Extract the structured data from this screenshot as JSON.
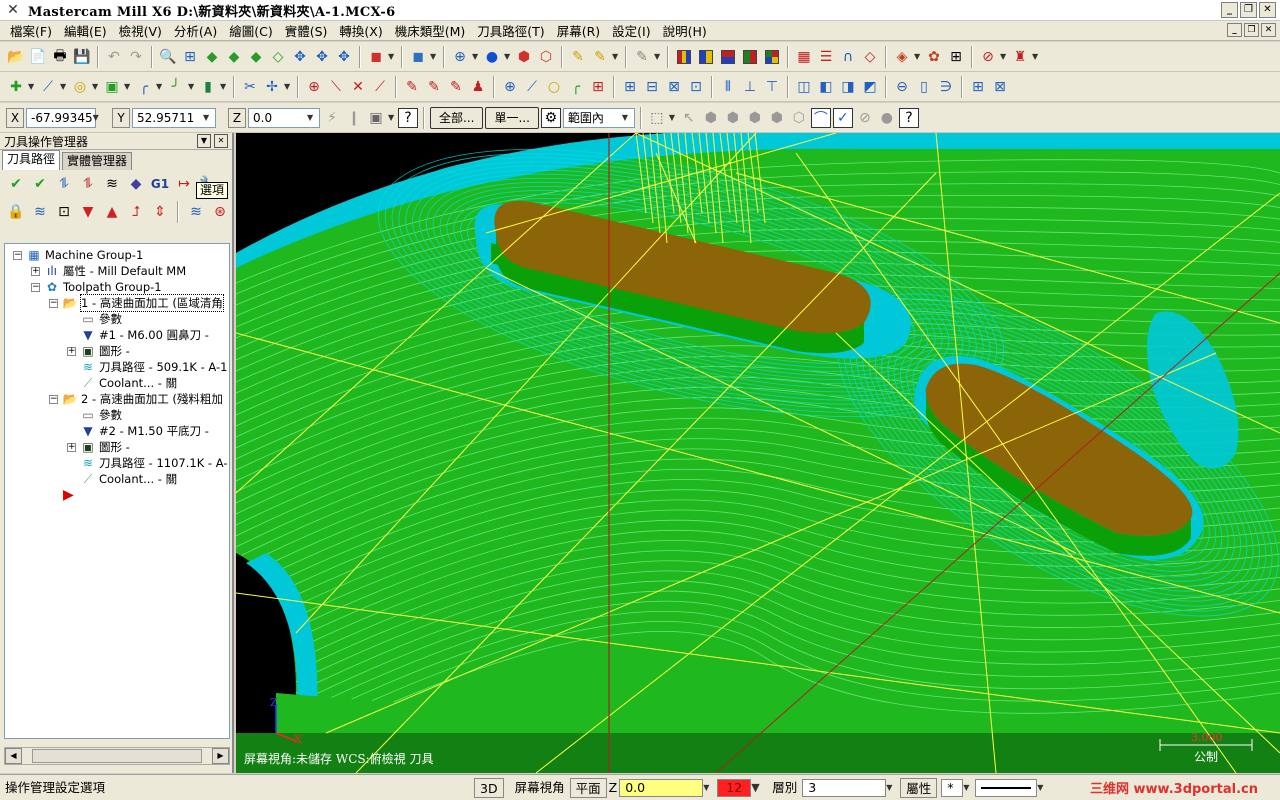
{
  "window": {
    "title": "Mastercam Mill X6  D:\\新資料夾\\新資料夾\\A-1.MCX-6"
  },
  "menu": [
    "檔案(F)",
    "編輯(E)",
    "檢視(V)",
    "分析(A)",
    "繪圖(C)",
    "實體(S)",
    "轉換(X)",
    "機床類型(M)",
    "刀具路徑(T)",
    "屏幕(R)",
    "設定(I)",
    "說明(H)"
  ],
  "coords": {
    "x_label": "X",
    "x_value": "-67.99345",
    "y_label": "Y",
    "y_value": "52.95711",
    "z_label": "Z",
    "z_value": "0.0"
  },
  "toolbar3": {
    "all_button": "全部...",
    "single_button": "單一...",
    "range_select": "範圍內"
  },
  "panel": {
    "title": "刀具操作管理器",
    "tabs": [
      "刀具路徑",
      "實體管理器"
    ],
    "tooltip": "選項",
    "g1_label": "G1"
  },
  "tree": [
    {
      "label": "Machine Group-1",
      "level": 0,
      "icon": "machine-group-icon",
      "expander": "−"
    },
    {
      "label": "屬性 - Mill Default MM",
      "level": 1,
      "icon": "properties-icon",
      "expander": "+"
    },
    {
      "label": "Toolpath Group-1",
      "level": 1,
      "icon": "toolpath-group-icon",
      "expander": "−"
    },
    {
      "label": "1 - 高速曲面加工 (區域清角",
      "level": 2,
      "icon": "operation-folder-icon",
      "expander": "−",
      "selected": true
    },
    {
      "label": "參數",
      "level": 3,
      "icon": "parameters-icon",
      "expander": ""
    },
    {
      "label": "#1 - M6.00 圓鼻刀 -",
      "level": 3,
      "icon": "tool-icon",
      "expander": ""
    },
    {
      "label": "圖形 -",
      "level": 3,
      "icon": "geometry-icon",
      "expander": "+"
    },
    {
      "label": "刀具路徑 - 509.1K - A-1",
      "level": 3,
      "icon": "toolpath-icon",
      "expander": ""
    },
    {
      "label": "Coolant... - 關",
      "level": 3,
      "icon": "coolant-icon",
      "expander": ""
    },
    {
      "label": "2 - 高速曲面加工 (殘料粗加",
      "level": 2,
      "icon": "operation-folder-icon",
      "expander": "−"
    },
    {
      "label": "參數",
      "level": 3,
      "icon": "parameters-icon",
      "expander": ""
    },
    {
      "label": "#2 - M1.50 平底刀 -",
      "level": 3,
      "icon": "tool-icon",
      "expander": ""
    },
    {
      "label": "圖形 -",
      "level": 3,
      "icon": "geometry-icon",
      "expander": "+"
    },
    {
      "label": "刀具路徑 - 1107.1K - A-",
      "level": 3,
      "icon": "toolpath-icon",
      "expander": ""
    },
    {
      "label": "Coolant... - 關",
      "level": 3,
      "icon": "coolant-icon",
      "expander": ""
    }
  ],
  "viewport": {
    "status_left": "屏幕視角:未儲存    WCS:俯檢視    刀具",
    "scale_value": "3.000",
    "unit": "公制",
    "axis_z": "Z",
    "axis_x": "X"
  },
  "statusbar": {
    "message": "操作管理設定選項",
    "mode_3d": "3D",
    "screen_view": "屏幕視角",
    "plane": "平面",
    "z_label": "Z",
    "z_value": "0.0",
    "color_value": "12",
    "level_label": "層別",
    "level_value": "3",
    "attributes": "屬性",
    "style": "*",
    "watermark": "三维网 www.3dportal.cn"
  },
  "colors": {
    "part": "#1fb81f",
    "wall": "#00c8d8",
    "boss": "#8b6508",
    "rapid": "#ffff40",
    "axis_red": "#b02020"
  }
}
